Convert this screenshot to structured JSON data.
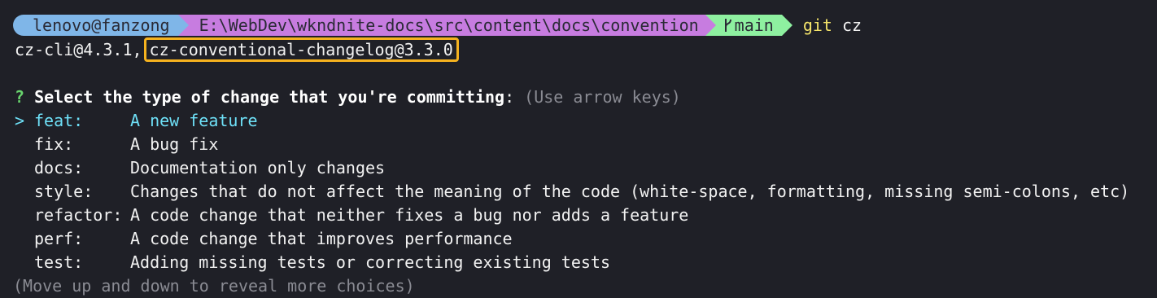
{
  "prompt": {
    "user": "lenovo@fanzong",
    "path": "E:\\WebDev\\wkndnite-docs\\src\\content\\docs\\convention",
    "branch": "main",
    "command": "git",
    "command_args": "cz",
    "colors": {
      "user_bg": "#7fb6e8",
      "path_bg": "#c77ce0",
      "git_bg": "#8ef0a0"
    }
  },
  "version_line": {
    "prefix": "cz-cli@4.3.1,",
    "highlighted": "cz-conventional-changelog@3.3.0",
    "highlight_color": "#f5b21f"
  },
  "question": {
    "mark": "?",
    "text": "Select the type of change that you're committing",
    "colon": ":",
    "hint": "(Use arrow keys)"
  },
  "choices": [
    {
      "pointer": ">",
      "name": "feat:",
      "desc": "A new feature",
      "selected": true
    },
    {
      "pointer": "",
      "name": "fix:",
      "desc": "A bug fix",
      "selected": false
    },
    {
      "pointer": "",
      "name": "docs:",
      "desc": "Documentation only changes",
      "selected": false
    },
    {
      "pointer": "",
      "name": "style:",
      "desc": "Changes that do not affect the meaning of the code (white-space, formatting, missing semi-colons, etc)",
      "selected": false
    },
    {
      "pointer": "",
      "name": "refactor:",
      "desc": "A code change that neither fixes a bug nor adds a feature",
      "selected": false
    },
    {
      "pointer": "",
      "name": "perf:",
      "desc": "A code change that improves performance",
      "selected": false
    },
    {
      "pointer": "",
      "name": "test:",
      "desc": "Adding missing tests or correcting existing tests",
      "selected": false
    }
  ],
  "footer": "(Move up and down to reveal more choices)"
}
